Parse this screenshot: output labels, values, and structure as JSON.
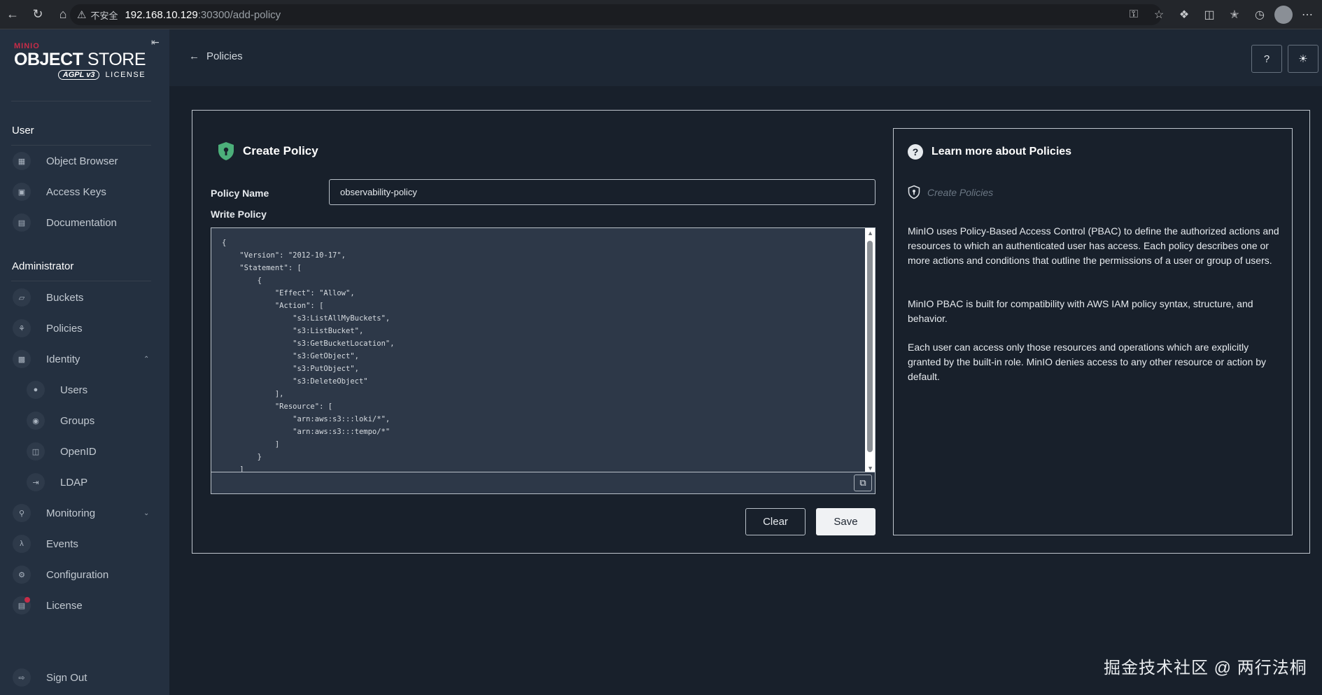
{
  "browser": {
    "url_warning": "不安全",
    "url_host": "192.168.10.129",
    "url_path": ":30300/add-policy"
  },
  "logo": {
    "brand": "MINIO",
    "title_bold": "OBJECT",
    "title_thin": "STORE",
    "badge": "AGPL v3",
    "license_word": "LICENSE"
  },
  "sidebar": {
    "user_heading": "User",
    "user_items": [
      {
        "label": "Object Browser"
      },
      {
        "label": "Access Keys"
      },
      {
        "label": "Documentation"
      }
    ],
    "admin_heading": "Administrator",
    "admin_items": [
      {
        "label": "Buckets"
      },
      {
        "label": "Policies"
      },
      {
        "label": "Identity"
      },
      {
        "label": "Users"
      },
      {
        "label": "Groups"
      },
      {
        "label": "OpenID"
      },
      {
        "label": "LDAP"
      },
      {
        "label": "Monitoring"
      },
      {
        "label": "Events"
      },
      {
        "label": "Configuration"
      },
      {
        "label": "License"
      }
    ],
    "sign_out": "Sign Out"
  },
  "header": {
    "back_label": "Policies"
  },
  "form": {
    "title": "Create Policy",
    "policy_name_label": "Policy Name",
    "policy_name_value": "observability-policy",
    "write_policy_label": "Write Policy",
    "policy_lines": [
      "{",
      "    \"Version\": \"2012-10-17\",",
      "    \"Statement\": [",
      "        {",
      "            \"Effect\": \"Allow\",",
      "            \"Action\": [",
      "                \"s3:ListAllMyBuckets\",",
      "                \"s3:ListBucket\",",
      "                \"s3:GetBucketLocation\",",
      "                \"s3:GetObject\",",
      "                \"s3:PutObject\",",
      "                \"s3:DeleteObject\"",
      "            ],",
      "            \"Resource\": [",
      "                \"arn:aws:s3:::loki/*\",",
      "                \"arn:aws:s3:::tempo/*\"",
      "            ]",
      "        }",
      "    ]"
    ],
    "clear_label": "Clear",
    "save_label": "Save"
  },
  "help": {
    "title": "Learn more about Policies",
    "link": "Create Policies",
    "paragraphs": [
      "MinIO uses Policy-Based Access Control (PBAC) to define the authorized actions and resources to which an authenticated user has access. Each policy describes one or more actions and conditions that outline the permissions of a user or group of users.",
      "MinIO PBAC is built for compatibility with AWS IAM policy syntax, structure, and behavior.",
      "Each user can access only those resources and operations which are explicitly granted by the built-in role. MinIO denies access to any other resource or action by default."
    ]
  },
  "watermark": "掘金技术社区 @ 两行法桐",
  "colors": {
    "sidebar_bg": "#243040",
    "page_bg": "#18202b",
    "brand_red": "#c72c48",
    "shield_green": "#4caf7a"
  }
}
